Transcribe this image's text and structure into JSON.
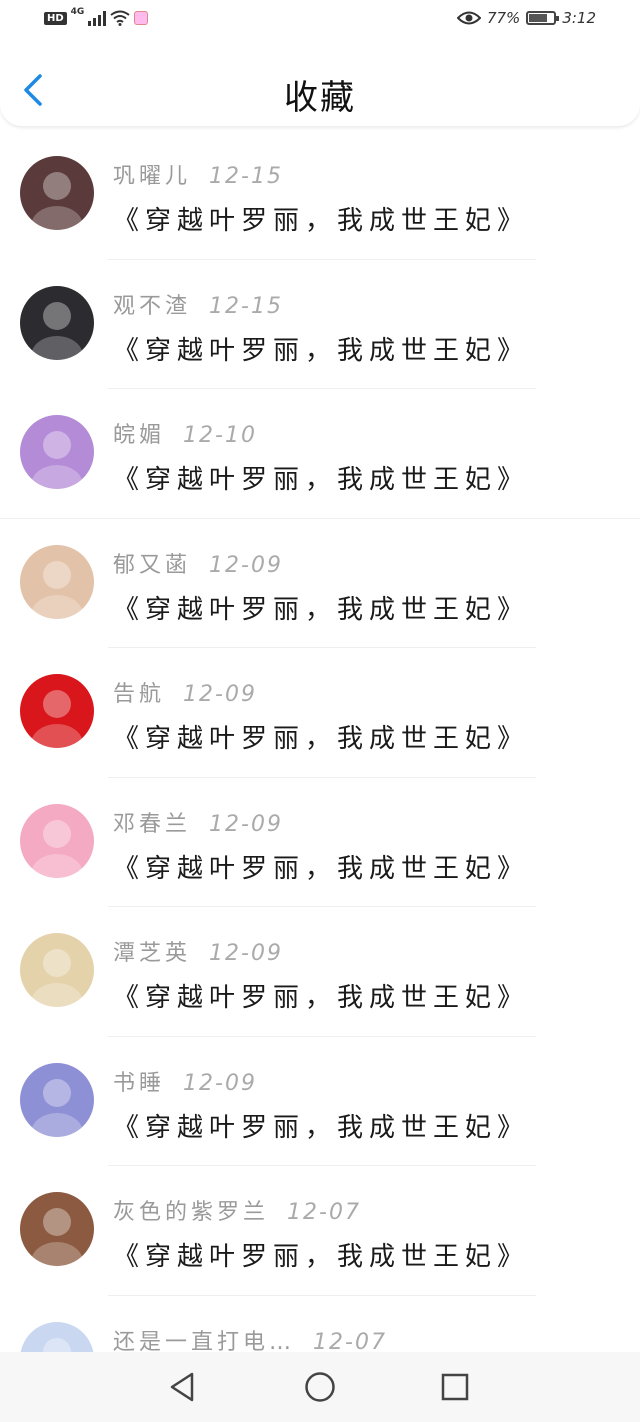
{
  "status_bar": {
    "hd": "HD",
    "network": "4G",
    "battery_percent": "77%",
    "battery_level": 0.77,
    "time": "3:12",
    "icons": [
      "signal-icon",
      "wifi-icon",
      "notification-icon",
      "eye-icon",
      "battery-icon"
    ]
  },
  "header": {
    "title": "收藏",
    "back_icon": "chevron-left-icon",
    "accent_color": "#1e88e5"
  },
  "favorites": [
    {
      "name": "巩曜儿",
      "date": "12-15",
      "book": "《穿越叶罗丽，我成世王妃》",
      "avatar_color": "#5a3a3a"
    },
    {
      "name": "观不渣",
      "date": "12-15",
      "book": "《穿越叶罗丽，我成世王妃》",
      "avatar_color": "#2b2b30"
    },
    {
      "name": "皖媚",
      "date": "12-10",
      "book": "《穿越叶罗丽，我成世王妃》",
      "avatar_color": "#b48bd6"
    },
    {
      "name": "郁又菡",
      "date": "12-09",
      "book": "《穿越叶罗丽，我成世王妃》",
      "avatar_color": "#e2c2a8"
    },
    {
      "name": "告航",
      "date": "12-09",
      "book": "《穿越叶罗丽，我成世王妃》",
      "avatar_color": "#d8161b"
    },
    {
      "name": "邓春兰",
      "date": "12-09",
      "book": "《穿越叶罗丽，我成世王妃》",
      "avatar_color": "#f4aac2"
    },
    {
      "name": "潭芝英",
      "date": "12-09",
      "book": "《穿越叶罗丽，我成世王妃》",
      "avatar_color": "#e4d2aa"
    },
    {
      "name": "书睡",
      "date": "12-09",
      "book": "《穿越叶罗丽，我成世王妃》",
      "avatar_color": "#8e90d6"
    },
    {
      "name": "灰色的紫罗兰",
      "date": "12-07",
      "book": "《穿越叶罗丽，我成世王妃》",
      "avatar_color": "#8b5a40"
    },
    {
      "name": "还是一直打电…",
      "date": "12-07",
      "book": "",
      "avatar_color": "#c9d8f0"
    }
  ],
  "nav_bar": {
    "icons": [
      "back-triangle-icon",
      "home-circle-icon",
      "recents-square-icon"
    ]
  }
}
